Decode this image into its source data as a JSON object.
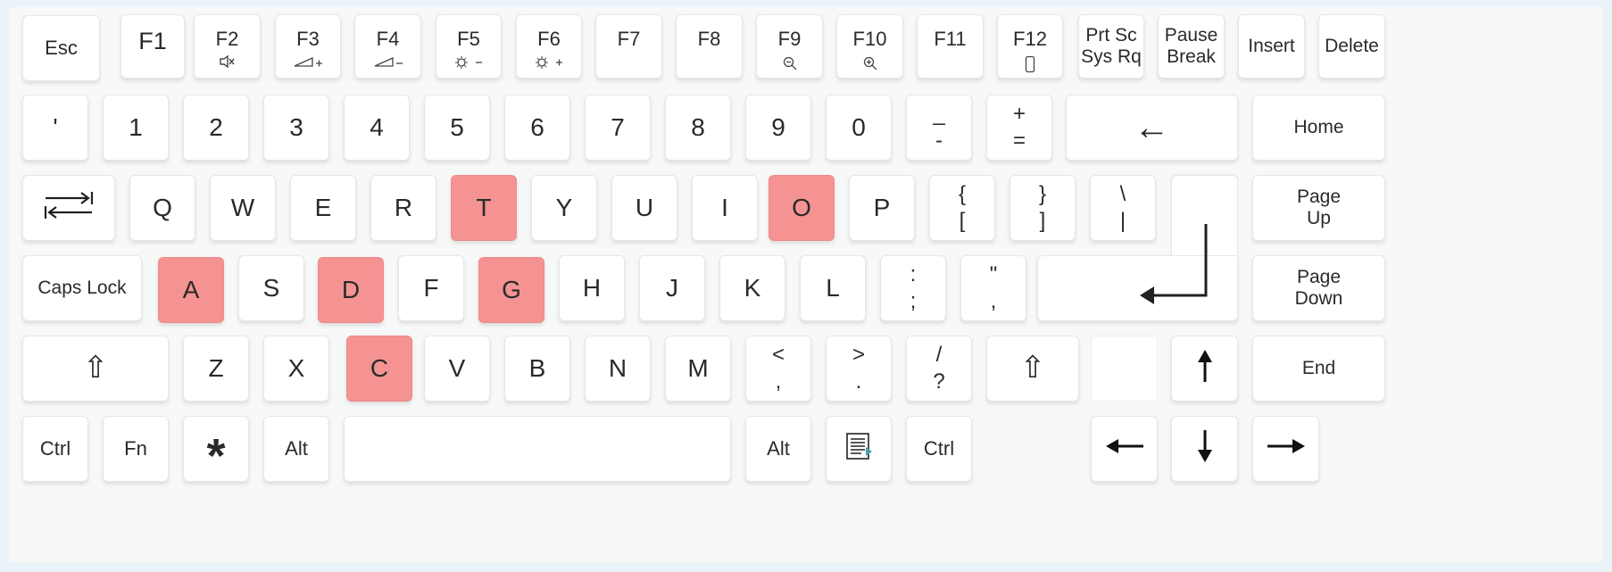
{
  "keyboard": {
    "highlight_color": "#f59393",
    "highlighted_keys": [
      "T",
      "O",
      "A",
      "D",
      "G",
      "C"
    ],
    "row0": {
      "esc": "Esc",
      "f1": "F1",
      "f2": "F2",
      "f2_icon": "mute-icon",
      "f3": "F3",
      "f3_icon": "volume-up-icon",
      "f4": "F4",
      "f4_icon": "volume-down-icon",
      "f5": "F5",
      "f5_icon": "brightness-down-icon",
      "f6": "F6",
      "f6_icon": "brightness-up-icon",
      "f7": "F7",
      "f8": "F8",
      "f9": "F9",
      "f9_icon": "zoom-out-icon",
      "f10": "F10",
      "f10_icon": "zoom-in-icon",
      "f11": "F11",
      "f12": "F12",
      "f12_icon": "phone-icon",
      "prtsc_1": "Prt Sc",
      "prtsc_2": "Sys Rq",
      "pause_1": "Pause",
      "pause_2": "Break",
      "insert": "Insert",
      "delete": "Delete"
    },
    "row1": {
      "backtick": "'",
      "k1": "1",
      "k2": "2",
      "k3": "3",
      "k4": "4",
      "k5": "5",
      "k6": "6",
      "k7": "7",
      "k8": "8",
      "k9": "9",
      "k0": "0",
      "minus_top": "_",
      "minus_bottom": "-",
      "equal_top": "+",
      "equal_bottom": "=",
      "backspace": "←",
      "home": "Home"
    },
    "row2": {
      "tab_icon": "tab-icon",
      "q": "Q",
      "w": "W",
      "e": "E",
      "r": "R",
      "t": "T",
      "y": "Y",
      "u": "U",
      "i": "I",
      "o": "O",
      "p": "P",
      "lbracket_top": "{",
      "lbracket_bottom": "[",
      "rbracket_top": "}",
      "rbracket_bottom": "]",
      "backslash_top": "\\",
      "backslash_bottom": "|",
      "pageup_1": "Page",
      "pageup_2": "Up"
    },
    "row3": {
      "caps": "Caps Lock",
      "a": "A",
      "s": "S",
      "d": "D",
      "f": "F",
      "g": "G",
      "h": "H",
      "j": "J",
      "k": "K",
      "l": "L",
      "semicolon_top": ":",
      "semicolon_bottom": ";",
      "quote_top": "\"",
      "quote_bottom": ",",
      "enter_icon": "enter-icon",
      "pagedown_1": "Page",
      "pagedown_2": "Down"
    },
    "row4": {
      "shift": "⇧",
      "z": "Z",
      "x": "X",
      "c": "C",
      "v": "V",
      "b": "B",
      "n": "N",
      "m": "M",
      "comma_top": "<",
      "comma_bottom": ",",
      "period_top": ">",
      "period_bottom": ".",
      "slash_top": "/",
      "slash_bottom": "?",
      "rshift": "⇧",
      "up_icon": "arrow-up-icon",
      "end": "End"
    },
    "row5": {
      "ctrl": "Ctrl",
      "fn": "Fn",
      "win": "*",
      "alt": "Alt",
      "ralt": "Alt",
      "menu_icon": "context-menu-icon",
      "rctrl": "Ctrl",
      "left_icon": "arrow-left-icon",
      "down_icon": "arrow-down-icon",
      "right_icon": "arrow-right-icon"
    }
  }
}
